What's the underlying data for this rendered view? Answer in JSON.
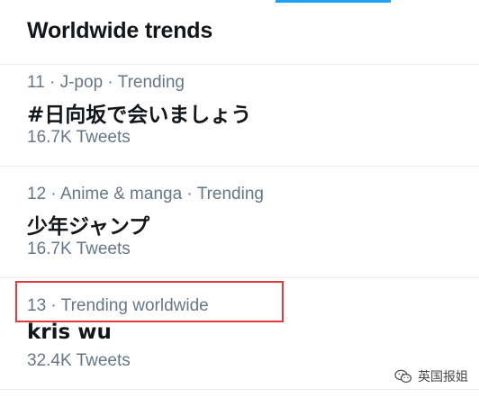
{
  "header": {
    "title": "Worldwide trends"
  },
  "trends": [
    {
      "meta": "11 · J-pop · Trending",
      "name": "#日向坂で会いましょう",
      "count": "16.7K Tweets"
    },
    {
      "meta": "12 · Anime & manga · Trending",
      "name": "少年ジャンプ",
      "count": "16.7K Tweets"
    },
    {
      "meta": "13 · Trending worldwide",
      "name": "kris wu",
      "count": "32.4K Tweets"
    }
  ],
  "watermark": {
    "text": "英国报姐",
    "icon": "wechat-icon"
  },
  "colors": {
    "accent": "#1da1f2",
    "muted_text": "#657786",
    "primary_text": "#14171a",
    "highlight": "#e03a3a"
  }
}
